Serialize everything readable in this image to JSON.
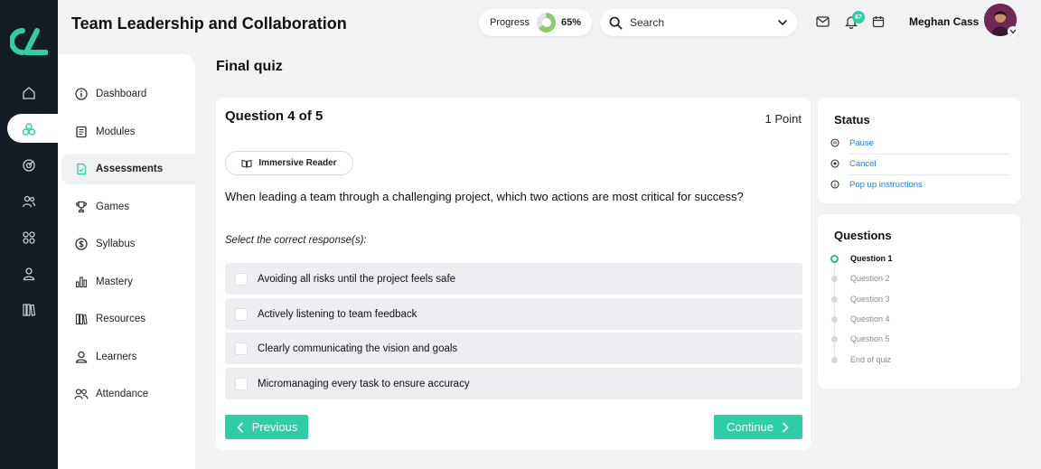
{
  "app": {
    "title": "Team Leadership and Collaboration",
    "accent_color": "#2ecfa6",
    "rail_color": "#141c26"
  },
  "header": {
    "progress_label": "Progress",
    "progress_percent": 65,
    "progress_text": "65%",
    "search_placeholder": "Search",
    "notification_count": "67",
    "user_name": "Meghan Cass"
  },
  "rail": {
    "items": [
      "home-icon",
      "cluster-icon",
      "target-icon",
      "group-icon",
      "grid-icon",
      "user-icon",
      "library-icon"
    ],
    "active_index": 1
  },
  "nav": {
    "items": [
      {
        "label": "Dashboard",
        "icon": "info-icon"
      },
      {
        "label": "Modules",
        "icon": "document-icon"
      },
      {
        "label": "Assessments",
        "icon": "assessment-file-icon",
        "active": true
      },
      {
        "label": "Games",
        "icon": "trophy-icon"
      },
      {
        "label": "Syllabus",
        "icon": "dollar-circle-icon"
      },
      {
        "label": "Mastery",
        "icon": "bar-chart-icon"
      },
      {
        "label": "Resources",
        "icon": "books-icon"
      },
      {
        "label": "Learners",
        "icon": "learner-icon"
      },
      {
        "label": "Attendance",
        "icon": "attendance-icon"
      }
    ]
  },
  "page": {
    "title": "Final quiz"
  },
  "question": {
    "heading": "Question 4 of 5",
    "points": "1 Point",
    "reader_label": "Immersive Reader",
    "text": "When leading a team through a challenging project, which two actions are most critical for success?",
    "instruction": "Select the correct response(s):",
    "options": [
      "Avoiding all risks until the project feels safe",
      "Actively listening to team feedback",
      "Clearly communicating the vision and goals",
      "Micromanaging every task to ensure accuracy"
    ],
    "prev_label": "Previous",
    "continue_label": "Continue"
  },
  "status": {
    "title": "Status",
    "links": [
      "Pause",
      "Cancel",
      "Pop up instructions"
    ],
    "link_color": "#1d7fd1"
  },
  "questions_panel": {
    "title": "Questions",
    "items": [
      "Question 1",
      "Question 2",
      "Question 3",
      "Question 4",
      "Question 5",
      "End of quiz"
    ],
    "current_index": 0
  }
}
